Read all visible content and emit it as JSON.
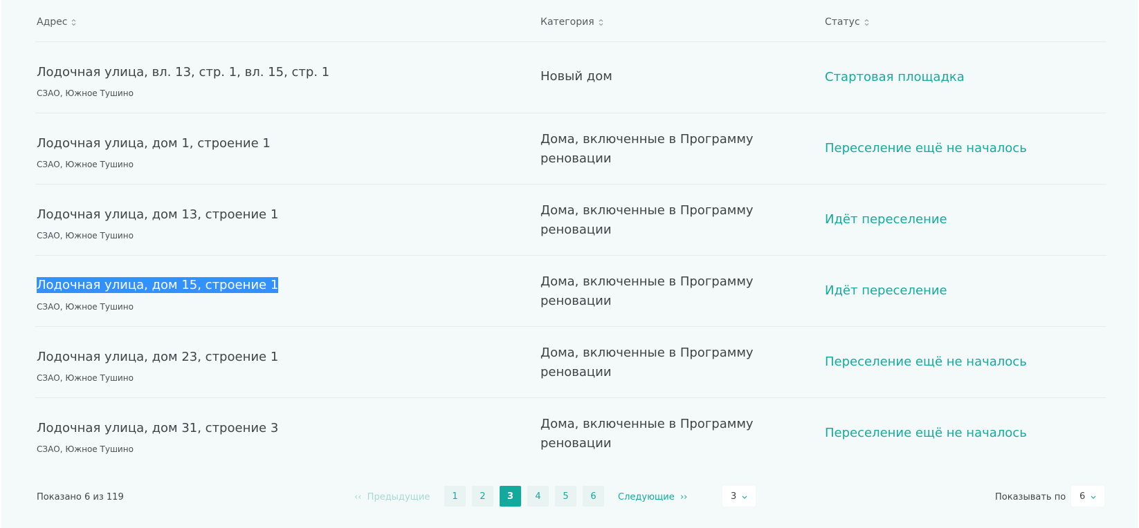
{
  "table": {
    "headers": {
      "address": "Адрес",
      "category": "Категория",
      "status": "Статус"
    },
    "rows": [
      {
        "title": "Лодочная улица, вл. 13, стр. 1, вл. 15, стр. 1",
        "subtitle": "СЗАО, Южное Тушино",
        "category": "Новый дом",
        "status": "Стартовая площадка"
      },
      {
        "title": "Лодочная улица, дом 1, строение 1",
        "subtitle": "СЗАО, Южное Тушино",
        "category": "Дома, включенные в Программу реновации",
        "status": "Переселение ещё не началось"
      },
      {
        "title": "Лодочная улица, дом 13, строение 1",
        "subtitle": "СЗАО, Южное Тушино",
        "category": "Дома, включенные в Программу реновации",
        "status": "Идёт переселение"
      },
      {
        "title": "Лодочная улица, дом 15, строение 1",
        "subtitle": "СЗАО, Южное Тушино",
        "category": "Дома, включенные в Программу реновации",
        "status": "Идёт переселение"
      },
      {
        "title": "Лодочная улица, дом 23, строение 1",
        "subtitle": "СЗАО, Южное Тушино",
        "category": "Дома, включенные в Программу реновации",
        "status": "Переселение ещё не началось"
      },
      {
        "title": "Лодочная улица, дом 31, строение 3",
        "subtitle": "СЗАО, Южное Тушино",
        "category": "Дома, включенные в Программу реновации",
        "status": "Переселение ещё не началось"
      }
    ]
  },
  "footer": {
    "shown_text": "Показано 6 из 119",
    "prev_label": "Предыдущие",
    "next_label": "Следующие",
    "pages": [
      "1",
      "2",
      "3",
      "4",
      "5",
      "6"
    ],
    "current_page": "3",
    "page_select_value": "3",
    "per_page_label": "Показывать по",
    "per_page_value": "6"
  },
  "colors": {
    "background": "#f4fafa",
    "accent": "#14aa9d",
    "active_page": "#13a99c",
    "selection": "#3390ff"
  },
  "icons": {
    "sort": "sort-icon",
    "prev": "double-chevron-left-icon",
    "next": "double-chevron-right-icon",
    "dropdown": "chevron-down-icon"
  }
}
